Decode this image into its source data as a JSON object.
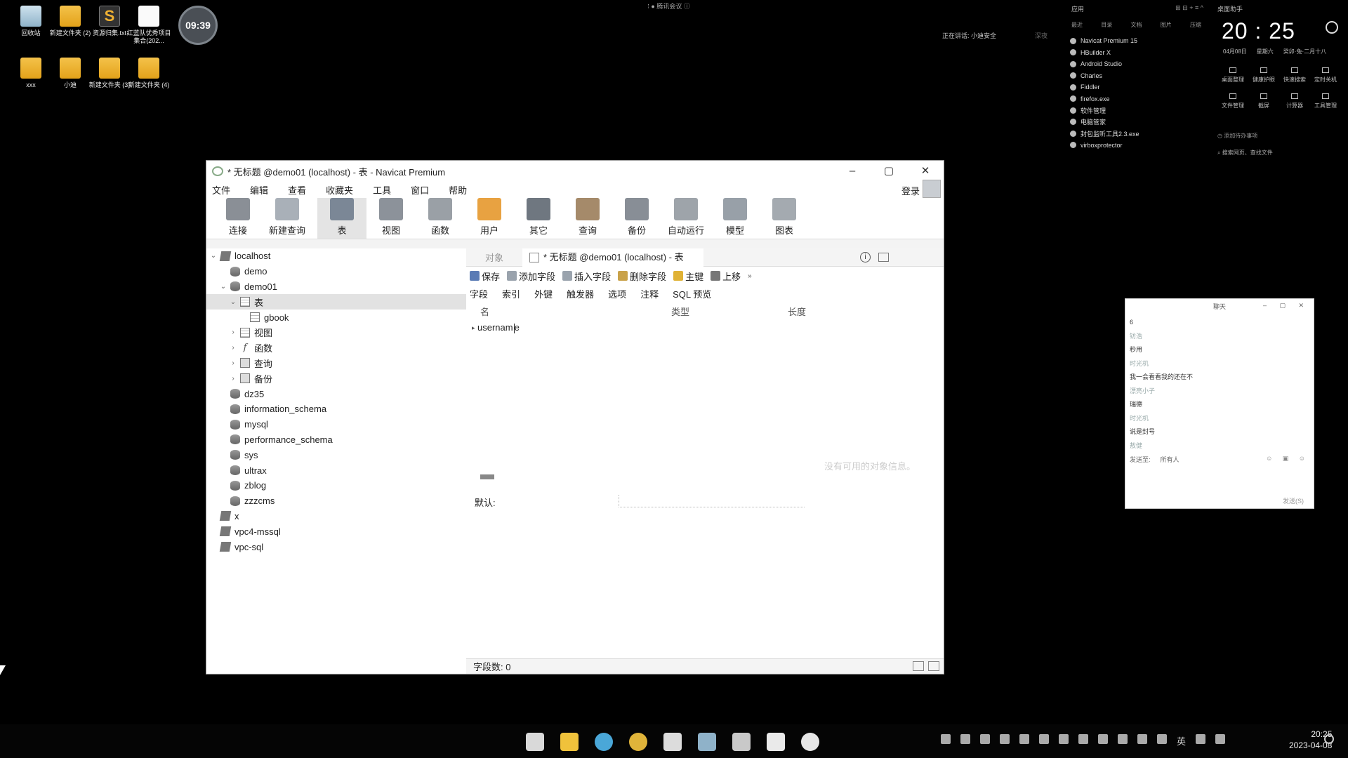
{
  "desktop": {
    "icons": [
      {
        "label": "回收站",
        "kind": "bin"
      },
      {
        "label": "新建文件夹 (2)",
        "kind": "folder"
      },
      {
        "label": "资源归集.txt",
        "kind": "sub"
      },
      {
        "label": "红蓝队优秀项目集合(202...",
        "kind": "doc"
      },
      {
        "label": "xxx",
        "kind": "folder"
      },
      {
        "label": "小迪",
        "kind": "folder"
      },
      {
        "label": "新建文件夹 (3)",
        "kind": "folder"
      },
      {
        "label": "新建文件夹 (4)",
        "kind": "folder"
      }
    ],
    "timer": "09:39",
    "meeting_label": "腾讯会议",
    "speaking_label": "正在讲话: 小迪安全",
    "speaking_tag": "深夜"
  },
  "apps_panel": {
    "title": "应用",
    "tabs": [
      "最近",
      "目录",
      "文档",
      "图片",
      "压缩"
    ],
    "items": [
      "Navicat Premium 15",
      "HBuilder X",
      "Android Studio",
      "Charles",
      "Fiddler",
      "firefox.exe",
      "软件管理",
      "电脑管家",
      "封包监听工具2.3.exe",
      "virboxprotector"
    ]
  },
  "clock_panel": {
    "title": "桌面助手",
    "time": "20 : 25",
    "date": "04月08日",
    "weekday": "星期六",
    "lunar": "癸卯·兔·二月十八",
    "tools": [
      "桌面整理",
      "健康护眼",
      "快速搜索",
      "定时关机",
      "文件管理",
      "截屏",
      "计算器",
      "工具管理"
    ],
    "todo": "添加待办事项",
    "search_files": "搜索网页、查找文件"
  },
  "chat": {
    "title": "聊天",
    "messages": [
      {
        "text": "6",
        "type": "msg"
      },
      {
        "text": "钫浩",
        "type": "name"
      },
      {
        "text": "秒用",
        "type": "msg"
      },
      {
        "text": "时光机",
        "type": "name"
      },
      {
        "text": "我一会看看我的还在不",
        "type": "msg"
      },
      {
        "text": "漂亮小子",
        "type": "name"
      },
      {
        "text": "瑞德",
        "type": "msg"
      },
      {
        "text": "时光机",
        "type": "name"
      },
      {
        "text": "说是封号",
        "type": "msg"
      },
      {
        "text": "敖健",
        "type": "name"
      }
    ],
    "send_to_label": "发送至:",
    "send_to_value": "所有人",
    "send_button": "发送(S)"
  },
  "window": {
    "title": "* 无标题 @demo01 (localhost) - 表 - Navicat Premium",
    "menu": [
      "文件",
      "编辑",
      "查看",
      "收藏夹",
      "工具",
      "窗口",
      "帮助"
    ],
    "login_label": "登录",
    "toolbar": [
      {
        "label": "连接",
        "color": "#8a8f96"
      },
      {
        "label": "新建查询",
        "color": "#a9b0b8"
      },
      {
        "label": "表",
        "color": "#7b8796"
      },
      {
        "label": "视图",
        "color": "#8c929a"
      },
      {
        "label": "函数",
        "color": "#9aa0a6"
      },
      {
        "label": "用户",
        "color": "#e8a241"
      },
      {
        "label": "其它",
        "color": "#6f7780"
      },
      {
        "label": "查询",
        "color": "#a58a6a"
      },
      {
        "label": "备份",
        "color": "#888e96"
      },
      {
        "label": "自动运行",
        "color": "#9ea4aa"
      },
      {
        "label": "模型",
        "color": "#98a0a8"
      },
      {
        "label": "图表",
        "color": "#a4aab0"
      }
    ],
    "tree": [
      {
        "label": "localhost",
        "icon": "server",
        "chev": "⌄",
        "indent": 0
      },
      {
        "label": "demo",
        "icon": "db",
        "chev": "",
        "indent": 1
      },
      {
        "label": "demo01",
        "icon": "db",
        "chev": "⌄",
        "indent": 1
      },
      {
        "label": "表",
        "icon": "table",
        "chev": "⌄",
        "indent": 2,
        "selected": true
      },
      {
        "label": "gbook",
        "icon": "table",
        "chev": "",
        "indent": 3
      },
      {
        "label": "视图",
        "icon": "table",
        "chev": "›",
        "indent": 2
      },
      {
        "label": "函数",
        "icon": "fn",
        "chev": "›",
        "indent": 2
      },
      {
        "label": "查询",
        "icon": "query",
        "chev": "›",
        "indent": 2
      },
      {
        "label": "备份",
        "icon": "backup",
        "chev": "›",
        "indent": 2
      },
      {
        "label": "dz35",
        "icon": "db",
        "chev": "",
        "indent": 1
      },
      {
        "label": "information_schema",
        "icon": "db",
        "chev": "",
        "indent": 1
      },
      {
        "label": "mysql",
        "icon": "db",
        "chev": "",
        "indent": 1
      },
      {
        "label": "performance_schema",
        "icon": "db",
        "chev": "",
        "indent": 1
      },
      {
        "label": "sys",
        "icon": "db",
        "chev": "",
        "indent": 1
      },
      {
        "label": "ultrax",
        "icon": "db",
        "chev": "",
        "indent": 1
      },
      {
        "label": "zblog",
        "icon": "db",
        "chev": "",
        "indent": 1
      },
      {
        "label": "zzzcms",
        "icon": "db",
        "chev": "",
        "indent": 1
      },
      {
        "label": "x",
        "icon": "server",
        "chev": "",
        "indent": 0
      },
      {
        "label": "vpc4-mssql",
        "icon": "server",
        "chev": "",
        "indent": 0
      },
      {
        "label": "vpc-sql",
        "icon": "server",
        "chev": "",
        "indent": 0
      }
    ],
    "tabs": {
      "objects": "对象",
      "active": "* 无标题 @demo01 (localhost) - 表"
    },
    "actions": [
      {
        "label": "保存",
        "color": "#5a7bb5"
      },
      {
        "label": "添加字段",
        "color": "#9aa3ad"
      },
      {
        "label": "插入字段",
        "color": "#9aa3ad"
      },
      {
        "label": "删除字段",
        "color": "#c9a24a"
      },
      {
        "label": "主键",
        "color": "#e0b235"
      },
      {
        "label": "上移",
        "color": "#777"
      }
    ],
    "subtabs": [
      "字段",
      "索引",
      "外键",
      "触发器",
      "选项",
      "注释",
      "SQL 预览"
    ],
    "columns": {
      "name": "名",
      "type": "类型",
      "length": "长度"
    },
    "field_value": "usernam",
    "field_end": "e",
    "no_detail": "没有可用的对象信息。",
    "default_label": "默认:",
    "status": "字段数: 0"
  },
  "taskbar": {
    "apps": [
      {
        "name": "start",
        "color": "#d9d9d9"
      },
      {
        "name": "explorer",
        "color": "#f0c23b"
      },
      {
        "name": "edge",
        "color": "#4aa7d8"
      },
      {
        "name": "chrome",
        "color": "#e0b43a"
      },
      {
        "name": "navicat",
        "color": "#dcdcdc"
      },
      {
        "name": "photos",
        "color": "#8fb2c9"
      },
      {
        "name": "p-app",
        "color": "#c9c9c9"
      },
      {
        "name": "phpstorm",
        "color": "#eaeaea"
      },
      {
        "name": "tencent",
        "color": "#e6e6e6"
      }
    ],
    "lang": "英",
    "time": "20:25",
    "date": "2023-04-08"
  }
}
